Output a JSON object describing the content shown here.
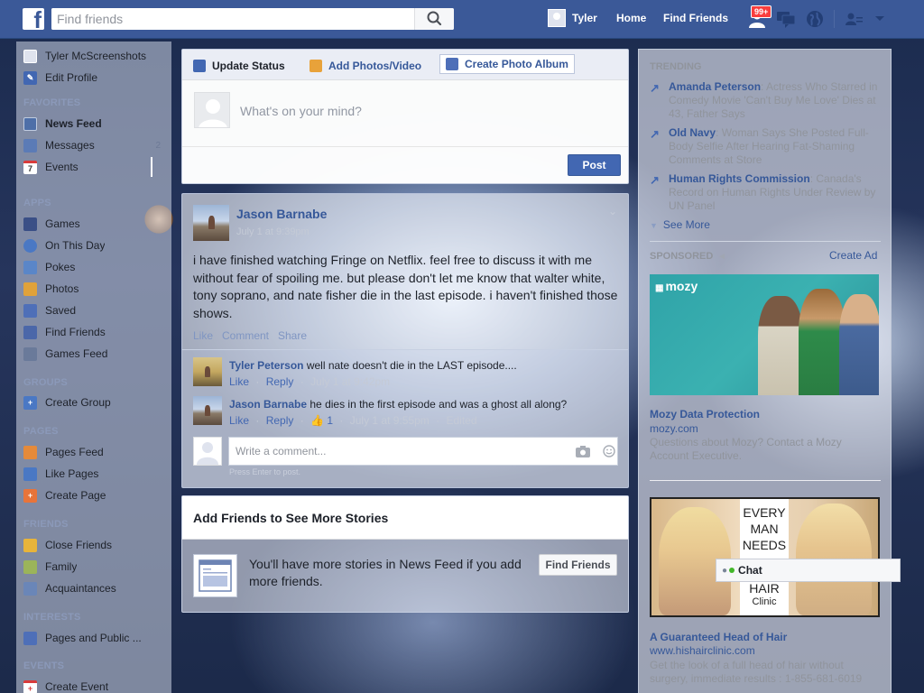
{
  "topbar": {
    "search_placeholder": "Find friends",
    "user_name": "Tyler",
    "home_label": "Home",
    "find_friends_label": "Find Friends",
    "notification_badge": "99+"
  },
  "left_nav": {
    "profile_name": "Tyler McScreenshots",
    "edit_profile": "Edit Profile",
    "sections": {
      "favorites": "FAVORITES",
      "apps": "APPS",
      "groups": "GROUPS",
      "pages": "PAGES",
      "friends": "FRIENDS",
      "interests": "INTERESTS",
      "events": "EVENTS"
    },
    "favorites": [
      "News Feed",
      "Messages",
      "Events"
    ],
    "messages_count": "2",
    "apps": [
      "Games",
      "On This Day",
      "Pokes",
      "Photos",
      "Saved",
      "Find Friends",
      "Games Feed"
    ],
    "groups": [
      "Create Group"
    ],
    "pages": [
      "Pages Feed",
      "Like Pages",
      "Create Page"
    ],
    "friends": [
      "Close Friends",
      "Family",
      "Acquaintances"
    ],
    "interests": [
      "Pages and Public ..."
    ],
    "events": [
      "Create Event"
    ],
    "events_icon_day": "7"
  },
  "composer": {
    "tab_status": "Update Status",
    "tab_photos": "Add Photos/Video",
    "tab_album": "Create Photo Album",
    "placeholder": "What's on your mind?",
    "post_label": "Post"
  },
  "story": {
    "author": "Jason Barnabe",
    "time": "July 1 at 9:39pm",
    "text": "i have finished watching Fringe on Netflix. feel free to discuss it with me without fear of spoiling me. but please don't let me know that walter white, tony soprano, and nate fisher die in the last episode. i haven't finished those shows.",
    "actions": [
      "Like",
      "Comment",
      "Share"
    ],
    "comments": [
      {
        "author": "Tyler Peterson",
        "text": " well nate doesn't die in the LAST episode....",
        "like": "Like",
        "reply": "Reply",
        "time": "July 1 at 9:42pm"
      },
      {
        "author": "Jason Barnabe",
        "text": " he dies in the first episode and was a ghost all along?",
        "like": "Like",
        "reply": "Reply",
        "likes": "1",
        "time": "July 1 at 9:55pm",
        "edited": "Edited"
      }
    ],
    "comment_placeholder": "Write a comment...",
    "comment_hint": "Press Enter to post."
  },
  "add_friends": {
    "title": "Add Friends to See More Stories",
    "text": "You'll have more stories in News Feed if you add more friends.",
    "button": "Find Friends"
  },
  "right_col": {
    "trending_label": "TRENDING",
    "trends": [
      {
        "name": "Amanda Peterson",
        "desc": ": Actress Who Starred in Comedy Movie 'Can't Buy Me Love' Dies at 43, Father Says"
      },
      {
        "name": "Old Navy",
        "desc": ": Woman Says She Posted Full-Body Selfie After Hearing Fat-Shaming Comments at Store"
      },
      {
        "name": "Human Rights Commission",
        "desc": ": Canada's Record on Human Rights Under Review by UN Panel"
      }
    ],
    "see_more": "See More",
    "sponsored_label": "SPONSORED",
    "create_ad": "Create Ad",
    "ads": [
      {
        "logo": "mozy",
        "title": "Mozy Data Protection",
        "url": "mozy.com",
        "desc": "Questions about Mozy? Contact a Mozy Account Executive."
      },
      {
        "image_text": [
          "EVERY",
          "MAN",
          "NEEDS",
          "HAIR",
          "Clinic"
        ],
        "title": "A Guaranteed Head of Hair",
        "url": "www.hishairclinic.com",
        "desc": "Get the look of a full head of hair without surgery, immediate results : 1-855-681-6019"
      }
    ]
  },
  "chat": {
    "label": "Chat"
  },
  "colors": {
    "brand": "#3b5998",
    "link": "#365899",
    "button": "#4267b2"
  }
}
